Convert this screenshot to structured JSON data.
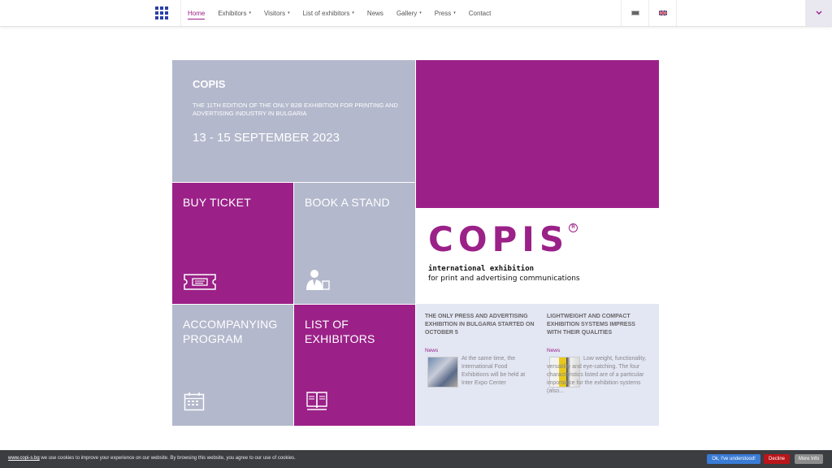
{
  "nav": {
    "items": [
      {
        "label": "Home",
        "active": true,
        "dropdown": false
      },
      {
        "label": "Exhibitors",
        "active": false,
        "dropdown": true
      },
      {
        "label": "Visitors",
        "active": false,
        "dropdown": true
      },
      {
        "label": "List of exhibitors",
        "active": false,
        "dropdown": true
      },
      {
        "label": "News",
        "active": false,
        "dropdown": false
      },
      {
        "label": "Gallery",
        "active": false,
        "dropdown": true
      },
      {
        "label": "Press",
        "active": false,
        "dropdown": true
      },
      {
        "label": "Contact",
        "active": false,
        "dropdown": false
      }
    ],
    "caret": "▾",
    "corner_icon": "chevron-down-icon"
  },
  "hero": {
    "title": "COPIS",
    "subtitle": "THE 11TH EDITION OF THE ONLY B2B EXHIBITION FOR PRINTING AND ADVERTISING INDUSTRY IN BULGARIA",
    "date": "13 - 15 SEPTEMBER 2023"
  },
  "tiles": {
    "buy_ticket": "BUY TICKET",
    "book_stand": "BOOK A STAND",
    "accompanying_1": "ACCOMPANYING",
    "accompanying_2": "PROGRAM",
    "list_1": "LIST OF",
    "list_2": "EXHIBITORS"
  },
  "logo": {
    "word": "COPIS",
    "reg": "R",
    "line1": "international exhibition",
    "line2": "for print and advertising communications"
  },
  "news": [
    {
      "title": "THE ONLY PRESS AND ADVERTISING EXHIBITION IN BULGARIA STARTED ON OCTOBER 5",
      "category": "News",
      "text": "At the same time, the International Food Exhibitions will be held at Inter Expo Center"
    },
    {
      "title": "LIGHTWEIGHT AND COMPACT EXHIBITION SYSTEMS IMPRESS WITH THEIR QUALITIES",
      "category": "News",
      "text": "Low weight, functionality, versatility and eye-catching. The four characteristics listed are of a particular importance for the exhibition systems (also..."
    }
  ],
  "cookie": {
    "link": "www.copi-s.bg",
    "text": " we use cookies to improve your experience on our website. By browsing this website, you agree to our use of cookies.",
    "ok": "Ok, I've understood!",
    "decline": "Decline",
    "more": "More Info"
  },
  "colors": {
    "purple": "#9b2188",
    "gray": "#b3b8cc",
    "news_bg": "#e3e6f3",
    "nav_logo": "#2a3fa8"
  }
}
